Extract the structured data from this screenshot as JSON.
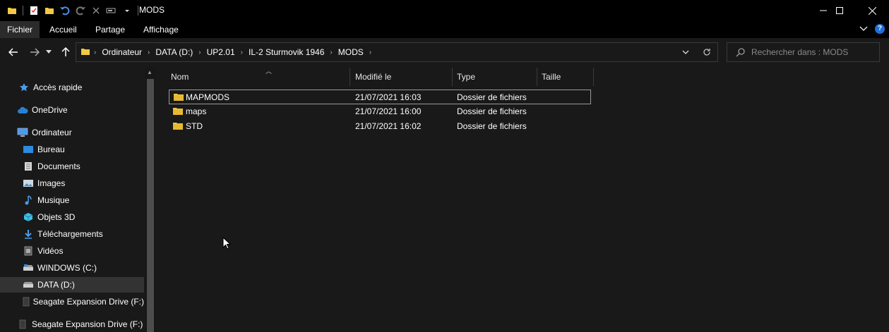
{
  "window": {
    "title": "MODS"
  },
  "ribbon": {
    "tabs": [
      {
        "label": "Fichier"
      },
      {
        "label": "Accueil"
      },
      {
        "label": "Partage"
      },
      {
        "label": "Affichage"
      }
    ]
  },
  "address": {
    "crumbs": [
      "Ordinateur",
      "DATA (D:)",
      "UP2.01",
      "IL-2 Sturmovik 1946",
      "MODS"
    ]
  },
  "search": {
    "placeholder": "Rechercher dans : MODS"
  },
  "nav": {
    "items": [
      {
        "label": "Accès rapide",
        "icon": "star-icon"
      },
      {
        "label": "OneDrive",
        "icon": "cloud-icon"
      },
      {
        "label": "Ordinateur",
        "icon": "computer-icon"
      },
      {
        "label": "Bureau",
        "icon": "desktop-icon"
      },
      {
        "label": "Documents",
        "icon": "documents-icon"
      },
      {
        "label": "Images",
        "icon": "images-icon"
      },
      {
        "label": "Musique",
        "icon": "music-icon"
      },
      {
        "label": "Objets 3D",
        "icon": "cube-icon"
      },
      {
        "label": "Téléchargements",
        "icon": "download-icon"
      },
      {
        "label": "Vidéos",
        "icon": "video-icon"
      },
      {
        "label": "WINDOWS (C:)",
        "icon": "drive-icon"
      },
      {
        "label": "DATA (D:)",
        "icon": "drive-icon"
      },
      {
        "label": "Seagate Expansion Drive (F:)",
        "icon": "external-drive-icon"
      },
      {
        "label": "Seagate Expansion Drive (F:)",
        "icon": "external-drive-icon"
      }
    ]
  },
  "columns": {
    "name": "Nom",
    "modified": "Modifié le",
    "type": "Type",
    "size": "Taille"
  },
  "files": [
    {
      "name": "MAPMODS",
      "modified": "21/07/2021 16:03",
      "type": "Dossier de fichiers"
    },
    {
      "name": "maps",
      "modified": "21/07/2021 16:00",
      "type": "Dossier de fichiers"
    },
    {
      "name": "STD",
      "modified": "21/07/2021 16:02",
      "type": "Dossier de fichiers"
    }
  ],
  "colors": {
    "folder": "#f3c842",
    "accent": "#1e6fd9",
    "background": "#191919"
  }
}
